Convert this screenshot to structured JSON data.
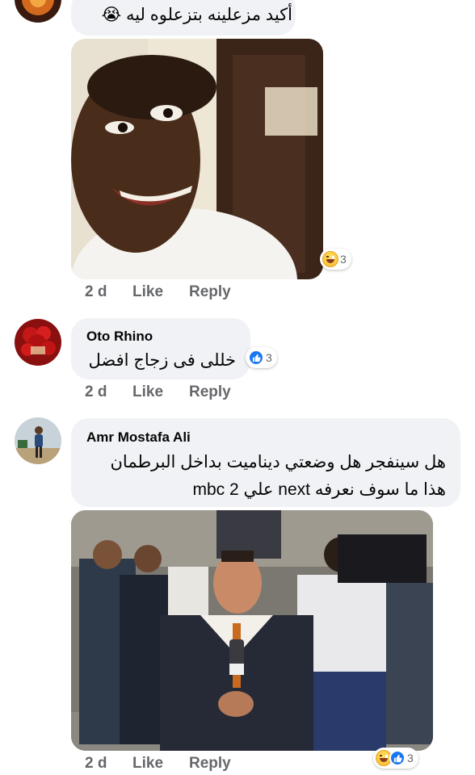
{
  "comments": [
    {
      "text": "أكيد مزعلينه بتزعلوه ليه 😭",
      "time": "2 d",
      "like_label": "Like",
      "reply_label": "Reply",
      "reaction_count": "3",
      "reaction_icons": [
        "haha-icon"
      ]
    },
    {
      "author": "Oto Rhino",
      "text": "خللى فى زجاج افضل",
      "time": "2 d",
      "like_label": "Like",
      "reply_label": "Reply",
      "reaction_count": "3",
      "reaction_icons": [
        "like-icon"
      ]
    },
    {
      "author": "Amr Mostafa Ali",
      "text_line1": "هل سينفجر هل وضعتي ديناميت بداخل البرطمان",
      "text_line2": "هذا ما سوف نعرفه next علي mbc 2",
      "time": "2 d",
      "like_label": "Like",
      "reply_label": "Reply",
      "reaction_count": "3",
      "reaction_icons": [
        "haha-icon",
        "like-icon"
      ]
    }
  ],
  "colors": {
    "bubble": "#f0f2f5",
    "meta_text": "#65676b",
    "like_blue": "#1877f2",
    "haha_yellow": "#f7b928"
  }
}
